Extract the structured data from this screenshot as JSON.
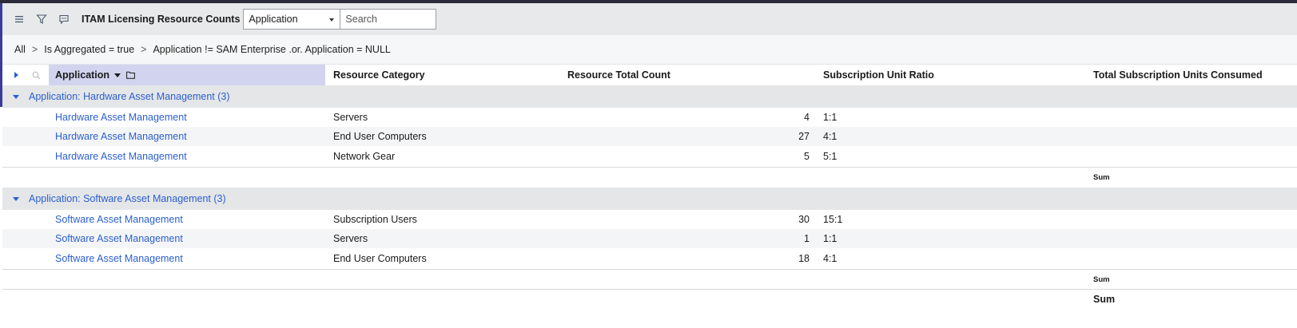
{
  "header": {
    "title": "ITAM Licensing Resource Counts",
    "select_value": "Application",
    "search_placeholder": "Search"
  },
  "breadcrumb": [
    "All",
    "Is Aggregated = true",
    "Application != SAM Enterprise .or. Application = NULL"
  ],
  "columns": {
    "application": "Application",
    "category": "Resource Category",
    "count": "Resource Total Count",
    "ratio": "Subscription Unit Ratio",
    "consumed": "Total Subscription Units Consumed"
  },
  "groups": [
    {
      "label": "Application: Hardware Asset Management (3)",
      "rows": [
        {
          "app": "Hardware Asset Management",
          "category": "Servers",
          "count": "4",
          "ratio": "1:1"
        },
        {
          "app": "Hardware Asset Management",
          "category": "End User Computers",
          "count": "27",
          "ratio": "4:1"
        },
        {
          "app": "Hardware Asset Management",
          "category": "Network Gear",
          "count": "5",
          "ratio": "5:1"
        }
      ],
      "sum_label": "Sum"
    },
    {
      "label": "Application: Software Asset Management (3)",
      "rows": [
        {
          "app": "Software Asset Management",
          "category": "Subscription Users",
          "count": "30",
          "ratio": "15:1"
        },
        {
          "app": "Software Asset Management",
          "category": "Servers",
          "count": "1",
          "ratio": "1:1"
        },
        {
          "app": "Software Asset Management",
          "category": "End User Computers",
          "count": "18",
          "ratio": "4:1"
        }
      ],
      "sum_label": "Sum"
    }
  ],
  "grand_sum_label": "Sum",
  "icons": {
    "menu": "hamburger-icon",
    "filter": "filter-icon",
    "comment": "comment-icon",
    "expand": "triangle-right-icon",
    "search": "search-icon",
    "sort": "sort-down-icon",
    "group": "folder-icon",
    "collapse": "triangle-down-icon"
  },
  "colors": {
    "link": "#2b5fd0",
    "header_bg": "#e8e9ea",
    "selected_column_bg": "#d2d4ef",
    "group_bg": "#e4e6e8"
  }
}
